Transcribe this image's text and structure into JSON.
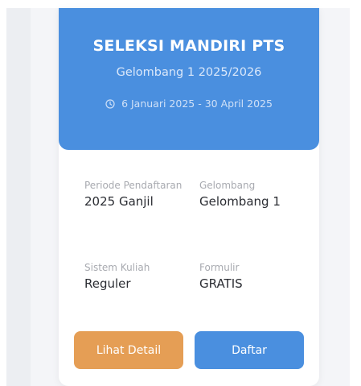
{
  "header": {
    "title": "SELEKSI MANDIRI PTS",
    "subtitle": "Gelombang 1 2025/2026",
    "date_range": "6 Januari 2025 - 30 April 2025",
    "icon": "clock-icon"
  },
  "info": {
    "periode_label": "Periode Pendaftaran",
    "periode_value": "2025 Ganjil",
    "gelombang_label": "Gelombang",
    "gelombang_value": "Gelombang 1",
    "sistem_label": "Sistem Kuliah",
    "sistem_value": "Reguler",
    "formulir_label": "Formulir",
    "formulir_value": "GRATIS"
  },
  "actions": {
    "detail_label": "Lihat Detail",
    "daftar_label": "Daftar"
  },
  "colors": {
    "header_bg": "#4a8fdf",
    "detail_button": "#e59e55",
    "daftar_button": "#4a8fdf"
  }
}
